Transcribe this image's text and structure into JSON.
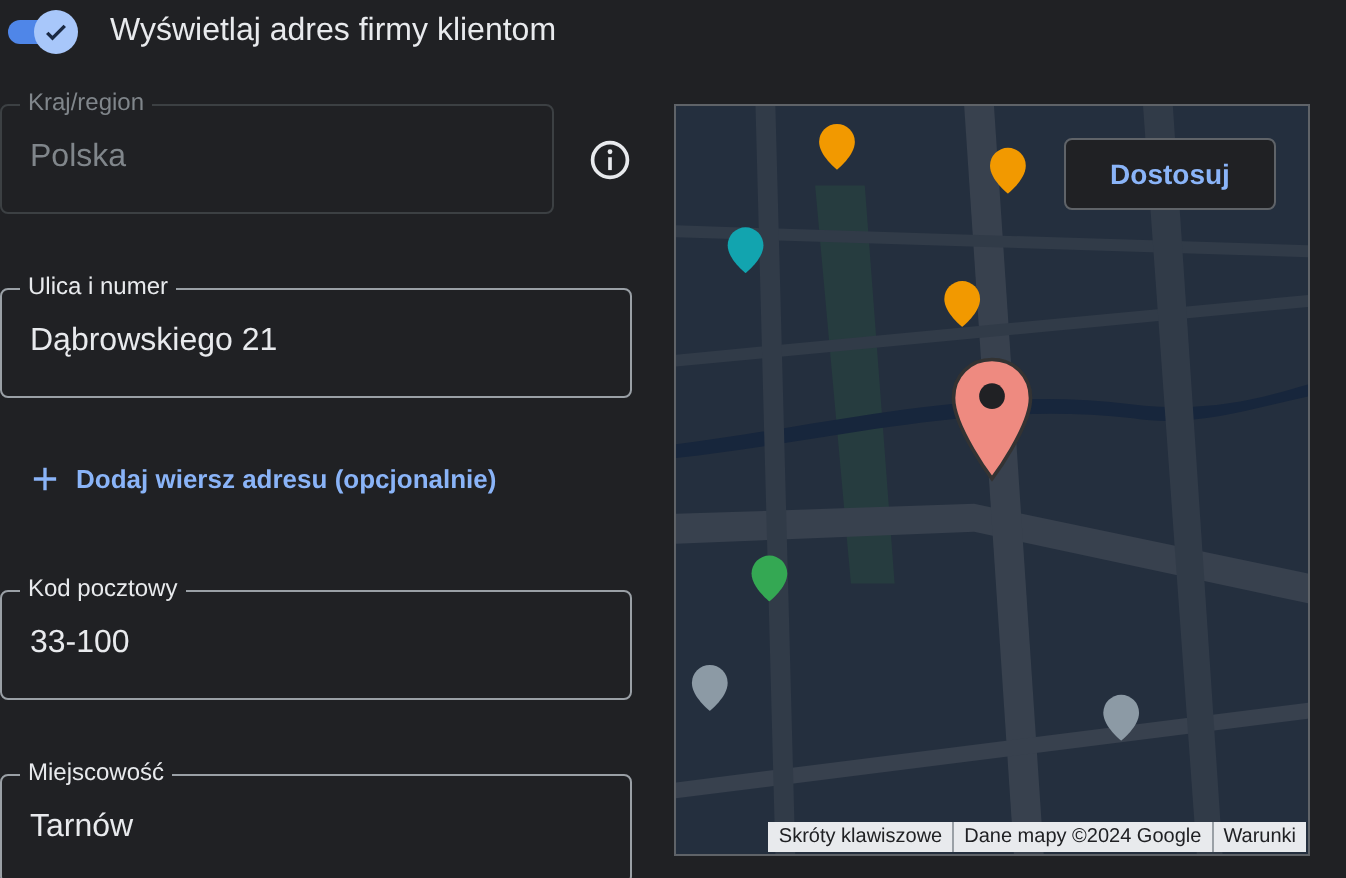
{
  "display_toggle": {
    "label": "Wyświetlaj adres firmy klientom",
    "on": true
  },
  "form": [
    {
      "kind": "field",
      "label": "Kraj/region",
      "value": "Polska",
      "disabled": true,
      "info": true
    },
    {
      "kind": "field",
      "label": "Ulica i numer",
      "value": "Dąbrowskiego 21",
      "disabled": false,
      "info": false
    },
    {
      "kind": "link",
      "label": "Dodaj wiersz adresu (opcjonalnie)"
    },
    {
      "kind": "field",
      "label": "Kod pocztowy",
      "value": "33-100",
      "disabled": false,
      "info": false
    },
    {
      "kind": "field",
      "label": "Miejscowość",
      "value": "Tarnów",
      "disabled": false,
      "info": false
    }
  ],
  "map": {
    "customize_button": "Dostosuj",
    "attribution": [
      "Skróty klawiszowe",
      "Dane mapy ©2024 Google",
      "Warunki"
    ]
  }
}
